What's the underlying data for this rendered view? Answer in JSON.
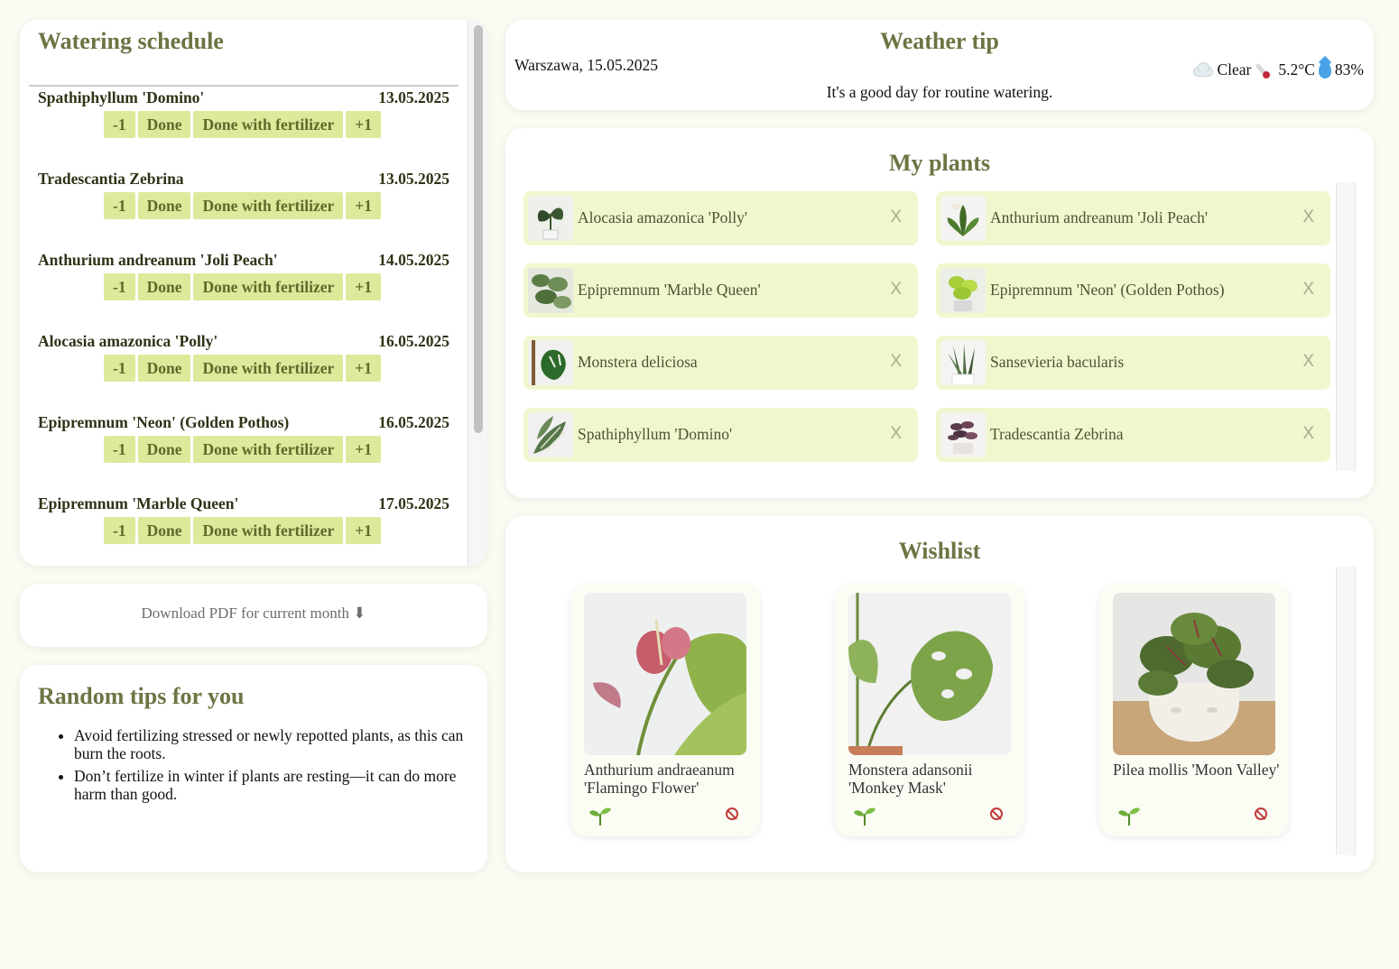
{
  "schedule": {
    "title": "Watering schedule",
    "items": [
      {
        "name": "Spathiphyllum 'Domino'",
        "date": "13.05.2025"
      },
      {
        "name": "Tradescantia Zebrina",
        "date": "13.05.2025"
      },
      {
        "name": "Anthurium andreanum 'Joli Peach'",
        "date": "14.05.2025"
      },
      {
        "name": "Alocasia amazonica 'Polly'",
        "date": "16.05.2025"
      },
      {
        "name": "Epipremnum 'Neon' (Golden Pothos)",
        "date": "16.05.2025"
      },
      {
        "name": "Epipremnum 'Marble Queen'",
        "date": "17.05.2025"
      }
    ],
    "buttons": {
      "minus": "-1",
      "done": "Done",
      "done_fert": "Done with fertilizer",
      "plus": "+1"
    }
  },
  "download": {
    "label": "Download PDF for current month ⬇"
  },
  "tips": {
    "title": "Random tips for you",
    "items": [
      "Avoid fertilizing stressed or newly repotted plants, as this can burn the roots.",
      "Don’t fertilize in winter if plants are resting—it can do more harm than good."
    ]
  },
  "weather": {
    "title": "Weather tip",
    "location_date": "Warszawa, 15.05.2025",
    "condition": "Clear",
    "temperature": "5.2°C",
    "humidity": "83%",
    "tip": "It's a good day for routine watering.",
    "icons": [
      "cloud-icon",
      "thermometer-icon",
      "droplet-icon"
    ]
  },
  "plants": {
    "title": "My plants",
    "remove_label": "X",
    "items": [
      {
        "name": "Alocasia amazonica 'Polly'"
      },
      {
        "name": "Anthurium andreanum 'Joli Peach'"
      },
      {
        "name": "Epipremnum 'Marble Queen'"
      },
      {
        "name": "Epipremnum 'Neon' (Golden Pothos)"
      },
      {
        "name": "Monstera deliciosa"
      },
      {
        "name": "Sansevieria bacularis"
      },
      {
        "name": "Spathiphyllum 'Domino'"
      },
      {
        "name": "Tradescantia Zebrina"
      }
    ]
  },
  "wishlist": {
    "title": "Wishlist",
    "items": [
      {
        "name": "Anthurium andraeanum 'Flamingo Flower'"
      },
      {
        "name": "Monstera adansonii 'Monkey Mask'"
      },
      {
        "name": "Pilea mollis 'Moon Valley'"
      }
    ],
    "icons": [
      "sprout-icon",
      "no-entry-icon"
    ]
  },
  "colors": {
    "accent": "#6b7543",
    "button_bg": "#dde99b",
    "plant_bg": "#f0f7cf",
    "page_bg": "#fafbf3"
  }
}
